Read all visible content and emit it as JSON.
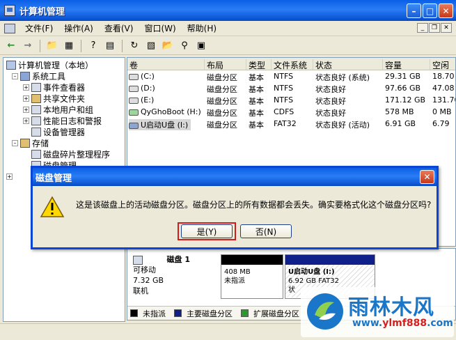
{
  "window": {
    "title": "计算机管理"
  },
  "menubar": {
    "items": [
      "文件(F)",
      "操作(A)",
      "查看(V)",
      "窗口(W)",
      "帮助(H)"
    ]
  },
  "tree": {
    "root": "计算机管理（本地）",
    "system_tools": "系统工具",
    "event_viewer": "事件查看器",
    "shared_folders": "共享文件夹",
    "local_users": "本地用户和组",
    "perf_logs": "性能日志和警报",
    "device_manager": "设备管理器",
    "storage": "存储",
    "defrag": "磁盘碎片整理程序",
    "disk_mgmt": "磁盘管理"
  },
  "list": {
    "columns": [
      "卷",
      "布局",
      "类型",
      "文件系统",
      "状态",
      "容量",
      "空闲"
    ],
    "rows": [
      [
        "(C:)",
        "磁盘分区",
        "基本",
        "NTFS",
        "状态良好 (系统)",
        "29.31 GB",
        "18.70"
      ],
      [
        "(D:)",
        "磁盘分区",
        "基本",
        "NTFS",
        "状态良好",
        "97.66 GB",
        "47.08"
      ],
      [
        "(E:)",
        "磁盘分区",
        "基本",
        "NTFS",
        "状态良好",
        "171.12 GB",
        "131.70"
      ],
      [
        "QyGhoBoot (H:)",
        "磁盘分区",
        "基本",
        "CDFS",
        "状态良好",
        "578 MB",
        "0 MB"
      ],
      [
        "U启动U盘 (I:)",
        "磁盘分区",
        "基本",
        "FAT32",
        "状态良好 (活动)",
        "6.91 GB",
        "6.79"
      ]
    ]
  },
  "graph": {
    "disk_name": "磁盘 1",
    "disk_type": "可移动",
    "disk_size": "7.32 GB",
    "disk_status": "联机",
    "p1_size": "408 MB",
    "p1_label": "未指派",
    "p2_name": "U启动U盘 (I:)",
    "p2_detail": "6.92 GB FAT32",
    "p2_status": "状"
  },
  "legend": {
    "items": [
      "未指派",
      "主要磁盘分区",
      "扩展磁盘分区"
    ]
  },
  "dialog": {
    "title": "磁盘管理",
    "message": "这是该磁盘上的活动磁盘分区。磁盘分区上的所有数据都会丢失。确实要格式化这个磁盘分区吗?",
    "yes": "是(Y)",
    "no": "否(N)"
  },
  "watermark": {
    "name": "雨林木风",
    "url_a": "www.",
    "url_b": "ylmf888",
    "url_c": ".com"
  }
}
